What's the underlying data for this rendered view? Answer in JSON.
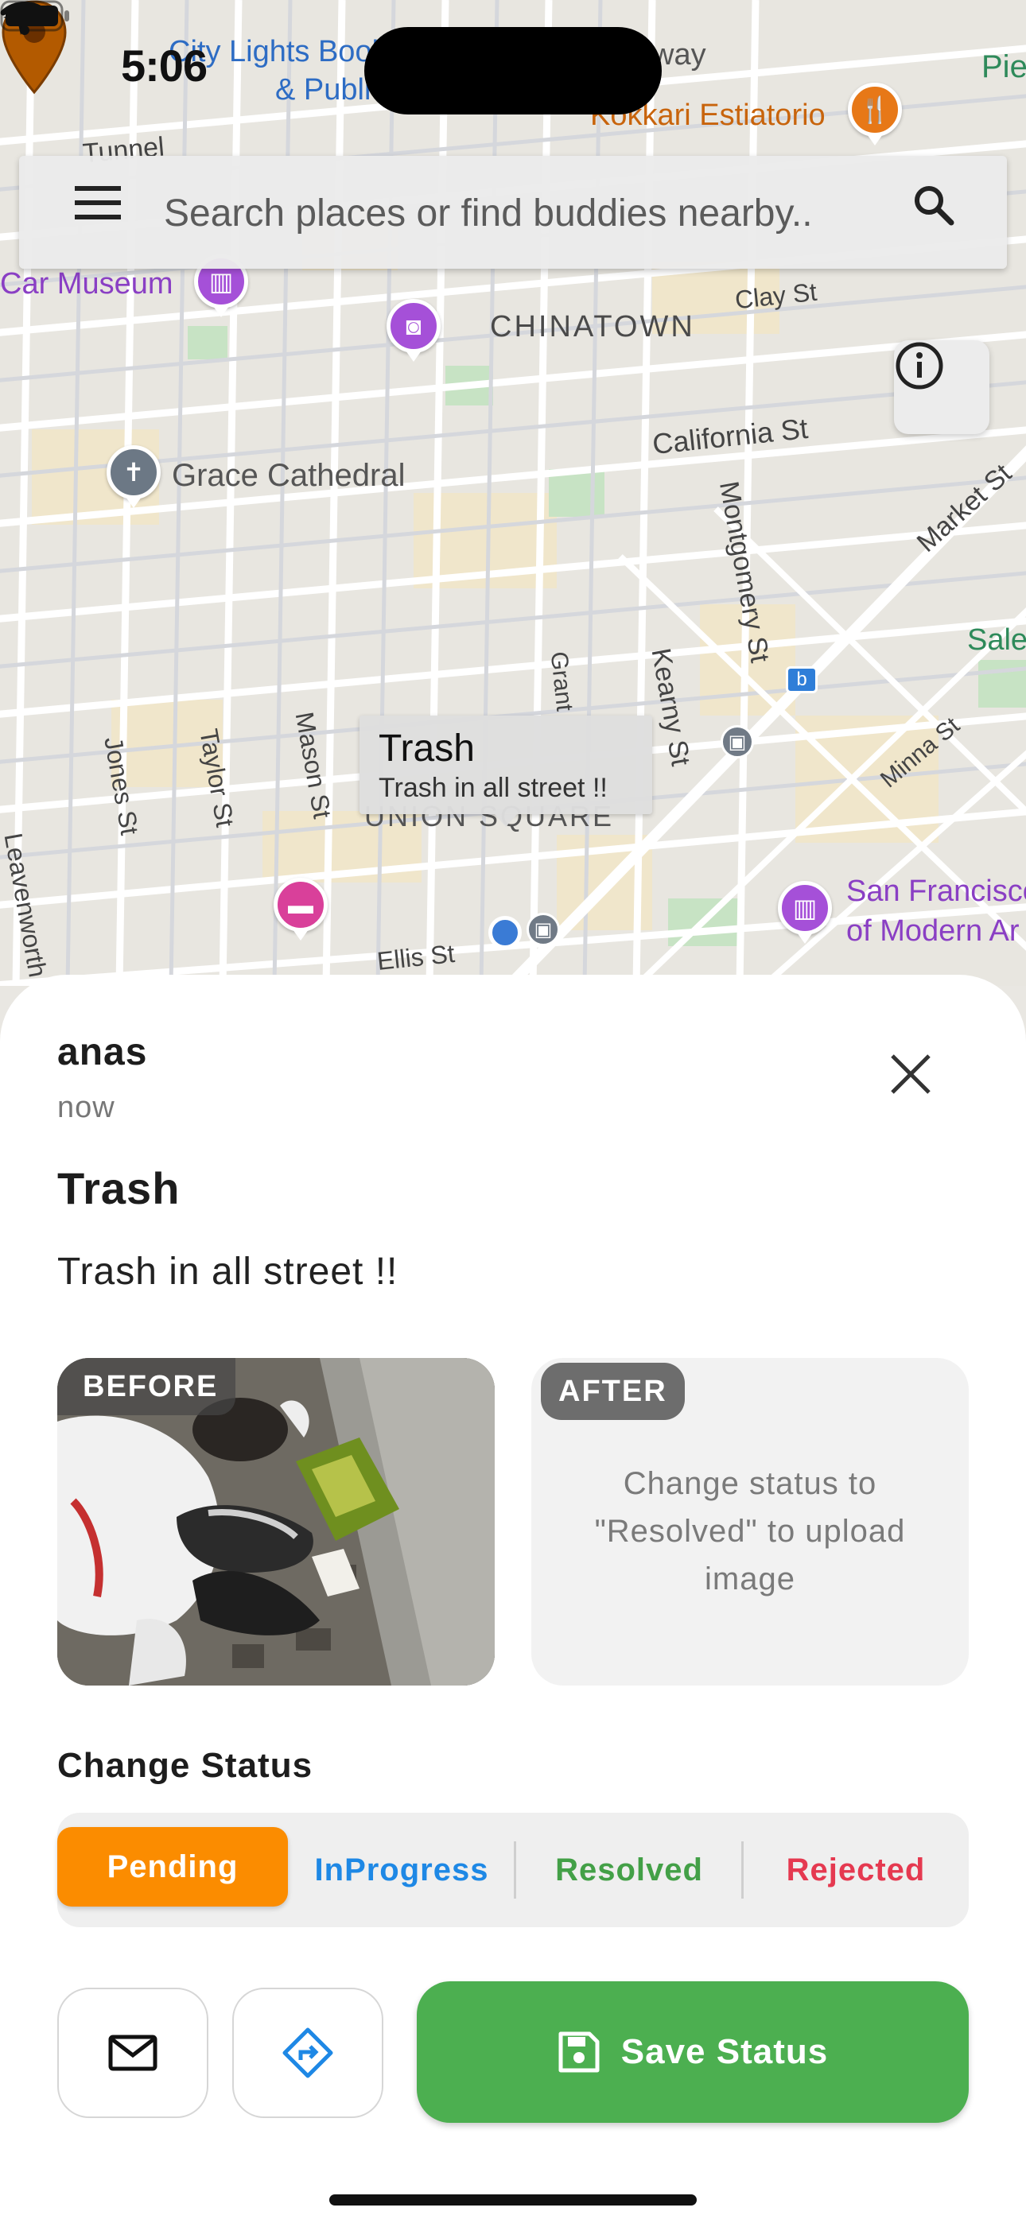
{
  "status_bar": {
    "time": "5:06"
  },
  "search": {
    "placeholder": "Search places or find buddies nearby.."
  },
  "map": {
    "labels": {
      "chinatown": "CHINATOWN",
      "grace_cathedral": "Grace Cathedral",
      "car_museum": "Car Museum",
      "clay_st": "Clay St",
      "california_st": "California St",
      "montgomery_st": "Montgomery St",
      "market_st": "Market St",
      "kearny_st": "Kearny St",
      "grant": "Grant",
      "jones_st": "Jones St",
      "taylor_st": "Taylor St",
      "mason_st": "Mason St",
      "leavenworth": "Leavenworth",
      "ellis_st": "Ellis St",
      "minna_st": "Minna St",
      "union_square": "UNION SQUARE",
      "sfmoma_line1": "San Francisco",
      "sfmoma_line2": "of Modern Ar",
      "kokkari": "Kokkari Estiatorio",
      "city_lights_line1": "City Lights Book",
      "city_lights_line2": "& Publi",
      "tunnel": "Tunnel",
      "way": "way",
      "pie": "Pie",
      "sale": "Sale"
    },
    "marker_info": {
      "title": "Trash",
      "snippet": "Trash in all street !!"
    }
  },
  "sheet": {
    "author": "anas",
    "timestamp": "now",
    "title": "Trash",
    "description": "Trash in all street !!",
    "before_label": "BEFORE",
    "after_label": "AFTER",
    "after_hint": "Change status to \"Resolved\" to upload image",
    "status_heading": "Change Status",
    "statuses": [
      "Pending",
      "InProgress",
      "Resolved",
      "Rejected"
    ],
    "selected_status": "Pending",
    "save_label": "Save Status"
  },
  "colors": {
    "pending": "#fb8c00",
    "inprogress": "#1e88e5",
    "resolved": "#43a047",
    "rejected": "#e53950",
    "save_button": "#4caf50",
    "marker": "#b35a00"
  },
  "icons": [
    "location-arrow-icon",
    "wifi-icon",
    "battery-icon",
    "menu-icon",
    "search-icon",
    "info-icon",
    "close-icon",
    "mail-icon",
    "directions-icon",
    "save-icon"
  ]
}
